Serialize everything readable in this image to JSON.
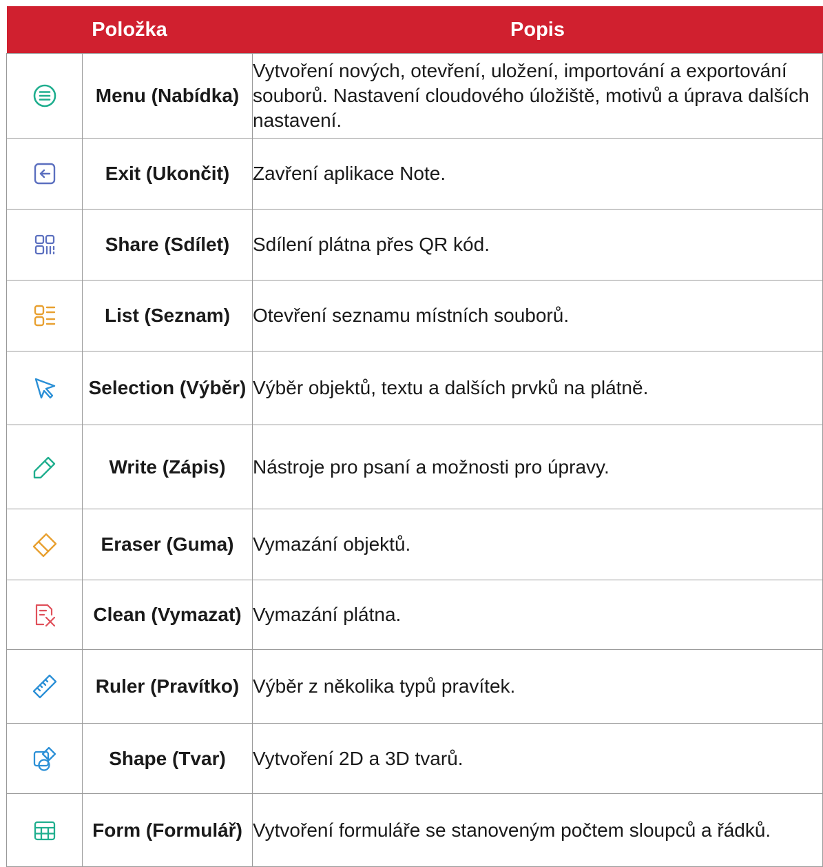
{
  "table": {
    "header": {
      "item": "Položka",
      "description": "Popis"
    },
    "rows": [
      {
        "icon": "menu-icon",
        "color": "#1fae8e",
        "item": "Menu (Nabídka)",
        "description": "Vytvoření nových, otevření, uložení, importování a exportování souborů. Nastavení cloudového úložiště, motivů a úprava dalších nastavení."
      },
      {
        "icon": "exit-icon",
        "color": "#5b6fbf",
        "item": "Exit (Ukončit)",
        "description": "Zavření aplikace Note."
      },
      {
        "icon": "qr-share-icon",
        "color": "#5b6fbf",
        "item": "Share (Sdílet)",
        "description": "Sdílení plátna přes QR kód."
      },
      {
        "icon": "list-icon",
        "color": "#e8a030",
        "item": "List (Seznam)",
        "description": "Otevření seznamu místních souborů."
      },
      {
        "icon": "cursor-icon",
        "color": "#2a8fd6",
        "item": "Selection (Výběr)",
        "description": "Výběr objektů, textu a dalších prvků na plátně."
      },
      {
        "icon": "pen-icon",
        "color": "#1fae8e",
        "item": "Write (Zápis)",
        "description": "Nástroje pro psaní a možnosti pro úpravy."
      },
      {
        "icon": "eraser-icon",
        "color": "#e8a030",
        "item": "Eraser (Guma)",
        "description": "Vymazání objektů."
      },
      {
        "icon": "clean-icon",
        "color": "#e0505a",
        "item": "Clean (Vymazat)",
        "description": "Vymazání plátna."
      },
      {
        "icon": "ruler-icon",
        "color": "#2a8fd6",
        "item": "Ruler (Pravítko)",
        "description": "Výběr z několika typů pravítek."
      },
      {
        "icon": "shape-icon",
        "color": "#2a8fd6",
        "item": "Shape (Tvar)",
        "description": "Vytvoření 2D a 3D tvarů."
      },
      {
        "icon": "table-icon",
        "color": "#1fae8e",
        "item": "Form (Formulář)",
        "description": "Vytvoření formuláře se stanoveným počtem sloupců a řádků."
      }
    ]
  }
}
